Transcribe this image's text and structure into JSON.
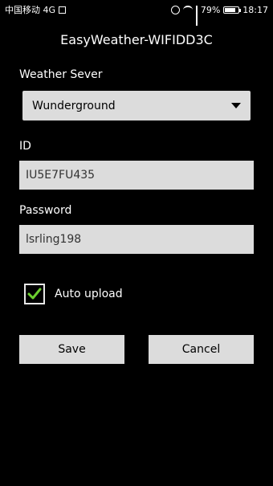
{
  "status_bar": {
    "carrier": "中国移动 4G",
    "battery_pct": "79%",
    "battery_level": 0.79,
    "time": "18:17",
    "icons": [
      "image-icon",
      "alarm-icon",
      "wifi-icon",
      "signal-icon",
      "battery-icon"
    ]
  },
  "title": "EasyWeather-WIFIDD3C",
  "weather_server": {
    "label": "Weather Sever",
    "selected": "Wunderground"
  },
  "id_field": {
    "label": "ID",
    "value": "IU5E7FU435"
  },
  "password_field": {
    "label": "Password",
    "value": "lsrling198"
  },
  "auto_upload": {
    "label": "Auto upload",
    "checked": true,
    "check_color": "#6ccf2f"
  },
  "buttons": {
    "save": "Save",
    "cancel": "Cancel"
  },
  "colors": {
    "background": "#000000",
    "control_bg": "#dcdcdc"
  }
}
